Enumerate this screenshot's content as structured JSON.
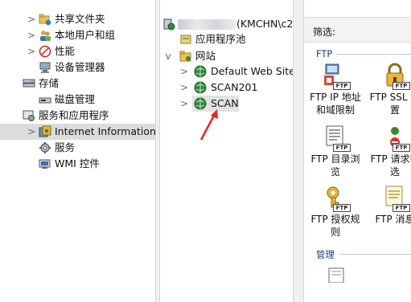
{
  "left_tree": {
    "items": [
      {
        "label": "共享文件夹",
        "icon": "shared-folder-icon",
        "expand": ">"
      },
      {
        "label": "本地用户和组",
        "icon": "users-icon",
        "expand": ">"
      },
      {
        "label": "性能",
        "icon": "performance-icon",
        "expand": ">"
      },
      {
        "label": "设备管理器",
        "icon": "device-manager-icon",
        "expand": ""
      },
      {
        "label": "存储",
        "icon": "storage-icon",
        "expand": ""
      },
      {
        "label": "磁盘管理",
        "icon": "disk-icon",
        "expand": ""
      },
      {
        "label": "服务和应用程序",
        "icon": "services-apps-icon",
        "expand": ""
      },
      {
        "label": "Internet Information S",
        "icon": "iis-icon",
        "expand": ">"
      },
      {
        "label": "服务",
        "icon": "services-icon",
        "expand": ""
      },
      {
        "label": "WMI 控件",
        "icon": "wmi-icon",
        "expand": ""
      }
    ]
  },
  "middle_tree": {
    "server_label": "(KMCHN\\c2",
    "app_pools": "应用程序池",
    "sites": "网站",
    "site_items": [
      "Default Web Site",
      "SCAN201",
      "SCAN"
    ],
    "expand_collapsed": ">",
    "expand_open": "v"
  },
  "features": {
    "filter_label": "筛选:",
    "groups": [
      {
        "name": "FTP"
      },
      {
        "name": "管理"
      }
    ],
    "items": [
      {
        "label": "FTP IP 地址和域限制",
        "icon": "ftp-ip-restrictions-icon"
      },
      {
        "label": "FTP SSL 设置",
        "icon": "ftp-ssl-icon"
      },
      {
        "label": "FTP 目录浏览",
        "icon": "ftp-directory-browsing-icon"
      },
      {
        "label": "FTP 请求筛选",
        "icon": "ftp-request-filtering-icon"
      },
      {
        "label": "FTP 授权规则",
        "icon": "ftp-authorization-icon"
      },
      {
        "label": "FTP 消息",
        "icon": "ftp-messages-icon"
      }
    ],
    "badge_text": "FTP"
  },
  "colors": {
    "selected_bg": "#dcdcdc",
    "group_text": "#1f3f73",
    "annotation": "#e8241c"
  }
}
